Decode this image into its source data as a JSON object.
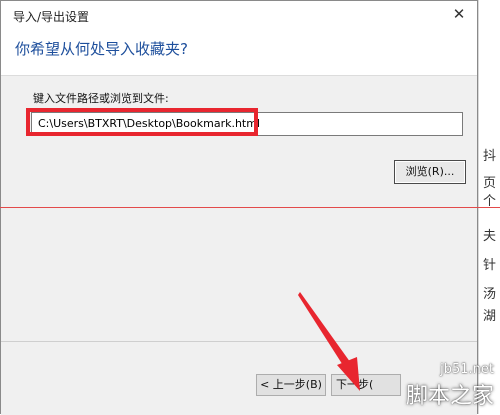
{
  "dialog": {
    "title": "导入/导出设置",
    "close_glyph": "✕",
    "heading": "你希望从何处导入收藏夹?",
    "path_label": "键入文件路径或浏览到文件:",
    "path_value": "C:\\Users\\BTXRT\\Desktop\\Bookmark.html",
    "browse_label": "浏览(R)...",
    "prev_label": "< 上一步(B)",
    "next_label": "下一步("
  },
  "background_strip": [
    "抖",
    "页",
    "个",
    "夫",
    "针",
    "汤",
    "湖"
  ],
  "watermark": {
    "site": "jb51.net",
    "name": "脚本之家"
  },
  "colors": {
    "highlight": "#e8262f",
    "heading": "#1e4f9c",
    "arrow": "#e8262f"
  }
}
